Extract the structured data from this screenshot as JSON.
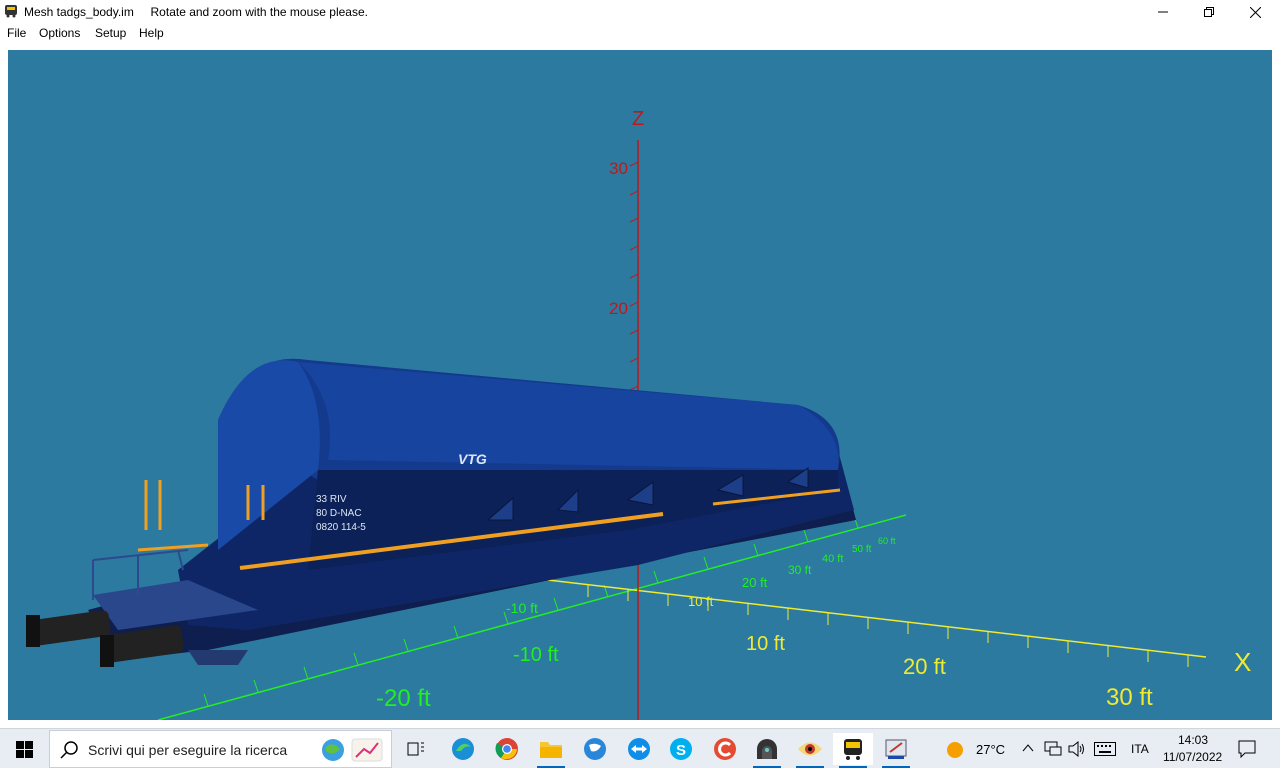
{
  "window": {
    "title": "Mesh tadgs_body.im",
    "hint": "Rotate and zoom with the mouse please."
  },
  "menu": [
    "File",
    "Options",
    "Setup",
    "Help"
  ],
  "viewport": {
    "bg_color": "#2c7aa0",
    "z_axis_label": "Z",
    "x_axis_label": "X",
    "z_ticks": [
      "30",
      "20"
    ],
    "x_ticks_yellow": [
      "10 ft",
      "20 ft",
      "30 ft",
      "10 ft"
    ],
    "neg_ticks_green": [
      "-10 ft",
      "-20 ft",
      "-10 ft"
    ],
    "y_ticks_green": [
      "20 ft",
      "30 ft",
      "40 ft",
      "50 ft",
      "60 ft"
    ],
    "wagon_marks": {
      "brand": "VTG",
      "line1": "33 RIV",
      "line2": "80 D-NAC",
      "line3": "0820 114-5"
    }
  },
  "taskbar": {
    "search_placeholder": "Scrivi qui per eseguire la ricerca",
    "weather": "27°C",
    "language": "ITA",
    "time": "14:03",
    "date": "11/07/2022"
  }
}
